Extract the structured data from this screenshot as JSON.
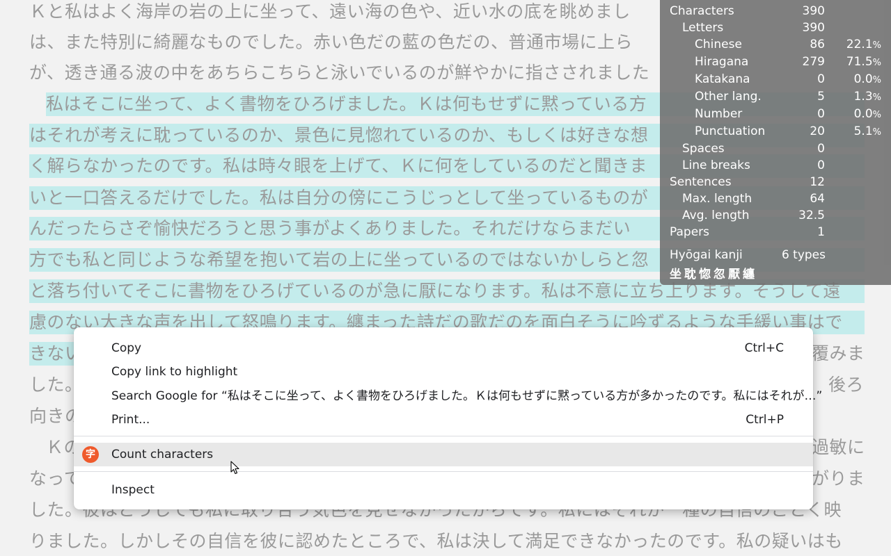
{
  "article": {
    "lines": [
      "Ｋと私はよく海岸の岩の上に坐って、遠い海の色や、近い水の底を眺めまし",
      "は、また特別に綺麗なものでした。赤い色だの藍の色だの、普通市場に上ら",
      "が、透き通る波の中をあちらこちらと泳いでいるのが鮮やかに指さされました",
      "私はそこに坐って、よく書物をひろげました。Ｋは何もせずに黙っている方",
      "はそれが考えに耽っているのか、景色に見惚れているのか、もしくは好きな想",
      "く解らなかったのです。私は時々眼を上げて、Ｋに何をしているのだと聞きま",
      "いと一口答えるだけでした。私は自分の傍にこうじっとして坐っているものが",
      "んだったらさぞ愉快だろうと思う事がよくありました。それだけならまだい",
      "方でも私と同じような希望を抱いて岩の上に坐っているのではないかしらと忽",
      "と落ち付いてそこに書物をひろげているのが急に厭になります。私は不意に立ち上ります。そうして遠",
      "慮のない大きな声を出して怒鳴ります。纏まった詩だの歌だのを面白そうに吟ずるような手緩い事はで",
      "きない",
      "した。",
      "向きの",
      "Ｋの",
      "なって",
      "した。彼はどうしても私に取り合う気色を見せなかったからです。私にはそれが一種の自信のごとく映",
      "りました。しかしその自信を彼に認めたところで、私は決して満足できなかったのです。私の疑いはも"
    ],
    "right_fragments": [
      "覆みま",
      "後ろ",
      "過敏に",
      "がりま"
    ]
  },
  "stats": {
    "rows": [
      {
        "label": "Characters",
        "value": "390",
        "pct": ""
      },
      {
        "label": "Letters",
        "value": "390",
        "pct": ""
      },
      {
        "label": "Chinese",
        "value": "86",
        "pct": "22.1"
      },
      {
        "label": "Hiragana",
        "value": "279",
        "pct": "71.5"
      },
      {
        "label": "Katakana",
        "value": "0",
        "pct": "0.0"
      },
      {
        "label": "Other lang.",
        "value": "5",
        "pct": "1.3"
      },
      {
        "label": "Number",
        "value": "0",
        "pct": "0.0"
      },
      {
        "label": "Punctuation",
        "value": "20",
        "pct": "5.1"
      },
      {
        "label": "Spaces",
        "value": "0",
        "pct": ""
      },
      {
        "label": "Line breaks",
        "value": "0",
        "pct": ""
      },
      {
        "label": "Sentences",
        "value": "12",
        "pct": ""
      },
      {
        "label": "Max. length",
        "value": "64",
        "pct": ""
      },
      {
        "label": "Avg. length",
        "value": "32.5",
        "pct": ""
      },
      {
        "label": "Papers",
        "value": "1",
        "pct": ""
      }
    ],
    "pct_sign": "%",
    "hyogai_label": "Hyōgai kanji",
    "hyogai_value": "6 types",
    "hyogai_chars": "坐耽惚忽厭纏"
  },
  "menu": {
    "copy": "Copy",
    "copy_shortcut": "Ctrl+C",
    "copy_link": "Copy link to highlight",
    "search": "Search Google for “私はそこに坐って、よく書物をひろげました。Ｋは何もせずに黙っている方が多かったのです。私にはそれが…”",
    "print": "Print...",
    "print_shortcut": "Ctrl+P",
    "count": "Count characters",
    "count_icon_char": "字",
    "inspect": "Inspect"
  },
  "colors": {
    "highlight": "#c4ecec",
    "extension_icon": "#ef5a2c"
  }
}
